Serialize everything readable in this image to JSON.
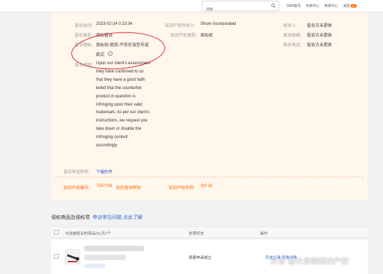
{
  "topbar": {
    "search_placeholder": "搜索",
    "links": [
      "1688首页",
      "买家中心",
      "卖家中心",
      "消息"
    ],
    "message_count": "99"
  },
  "complaint": {
    "time_label": "投诉时间:",
    "time_value": "2023-02-24 0:23:34",
    "type_label": "投诉类型:",
    "type_value": "商标投诉",
    "reason_label": "投诉理由:",
    "reason_value_line1": "商标权-假货-不存在该型号或",
    "reason_value_line2": "款式",
    "desc_label": "投诉说明:",
    "desc_lines": [
      "Upon our client's assessment",
      "they have confirmed to us",
      "that they have a good faith",
      "belief that the counterfeit",
      "product in question is",
      "infringing upon their valid",
      "trademark. As per our client's",
      "instructions, we request you",
      "take down or disable the",
      "infringing content",
      "accordingly."
    ],
    "evidence_label": "投诉举证附件:",
    "evidence_link": "下载附件",
    "owner_label": "知识产权所有人:",
    "owner_value": "Shure Incorporated",
    "ip_type_label": "知识产权类型:",
    "ip_type_value": "商标权",
    "contact_label": "联系人:",
    "contact_value": "投诉方未提供",
    "email_label": "联系邮箱:",
    "email_value": "投诉方未提供",
    "phone_label": "联系电话:",
    "phone_value": "投诉方未提供",
    "ip_no_label": "知识产权编号:",
    "ip_no_value": "7547749",
    "ip_query_link": "权利查询帮助",
    "ip_name_label": "知识产权名称:",
    "ip_name_value": "SM 58"
  },
  "goods": {
    "title": "侵权商品及侵权项",
    "faq_link": "申诉常见问题 点此了解",
    "col_goods": "勾选被投诉的商品(0),共2个",
    "col_status": "处理状态",
    "col_action": "操作",
    "row_status": "卖家申诉成立",
    "row_action": "历史记录 查看详情"
  },
  "watermark": "头条 @大隶聊知识产权"
}
